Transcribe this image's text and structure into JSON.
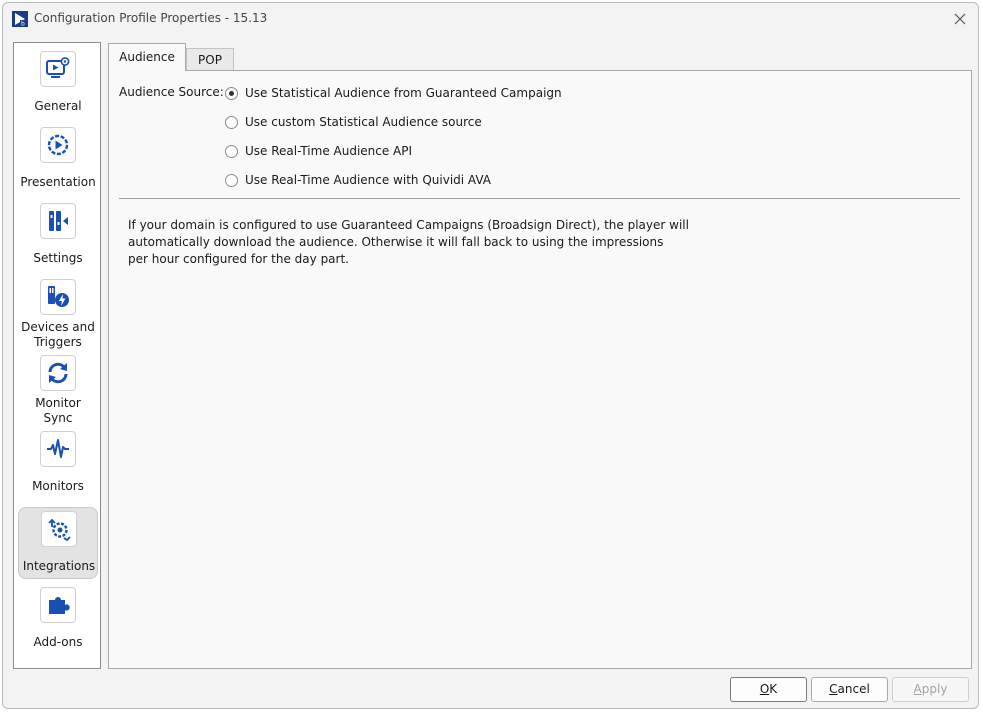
{
  "window": {
    "title": "Configuration Profile Properties - 15.13"
  },
  "sidebar": {
    "items": [
      {
        "label": "General",
        "icon": "monitor-play-gear-icon"
      },
      {
        "label": "Presentation",
        "icon": "play-circle-icon"
      },
      {
        "label": "Settings",
        "icon": "settings-panel-icon"
      },
      {
        "label": "Devices and\nTriggers",
        "icon": "device-lightning-icon"
      },
      {
        "label": "Monitor\nSync",
        "icon": "sync-arrows-icon"
      },
      {
        "label": "Monitors",
        "icon": "pulse-wave-icon"
      },
      {
        "label": "Integrations",
        "icon": "integration-gear-icon",
        "active": true
      },
      {
        "label": "Add-ons",
        "icon": "puzzle-piece-icon"
      }
    ]
  },
  "tabs": [
    {
      "label": "Audience",
      "active": true
    },
    {
      "label": "POP",
      "active": false
    }
  ],
  "audience": {
    "source_label": "Audience Source:",
    "options": [
      {
        "label": "Use Statistical Audience from Guaranteed Campaign",
        "checked": true
      },
      {
        "label": "Use custom Statistical Audience source",
        "checked": false
      },
      {
        "label": "Use Real-Time Audience API",
        "checked": false
      },
      {
        "label": "Use Real-Time Audience with Quividi AVA",
        "checked": false
      }
    ],
    "help_lines": [
      "If your domain is configured to use Guaranteed Campaigns (Broadsign Direct), the player will",
      "automatically download the audience. Otherwise it will fall back to using the impressions",
      "per hour configured for the day part."
    ]
  },
  "buttons": {
    "ok_first": "O",
    "ok_rest": "K",
    "cancel_first": "C",
    "cancel_rest": "ancel",
    "apply_first": "A",
    "apply_rest": "pply"
  },
  "colors": {
    "accent": "#1a4fb5",
    "active_item_bg": "#e3e3e3"
  }
}
